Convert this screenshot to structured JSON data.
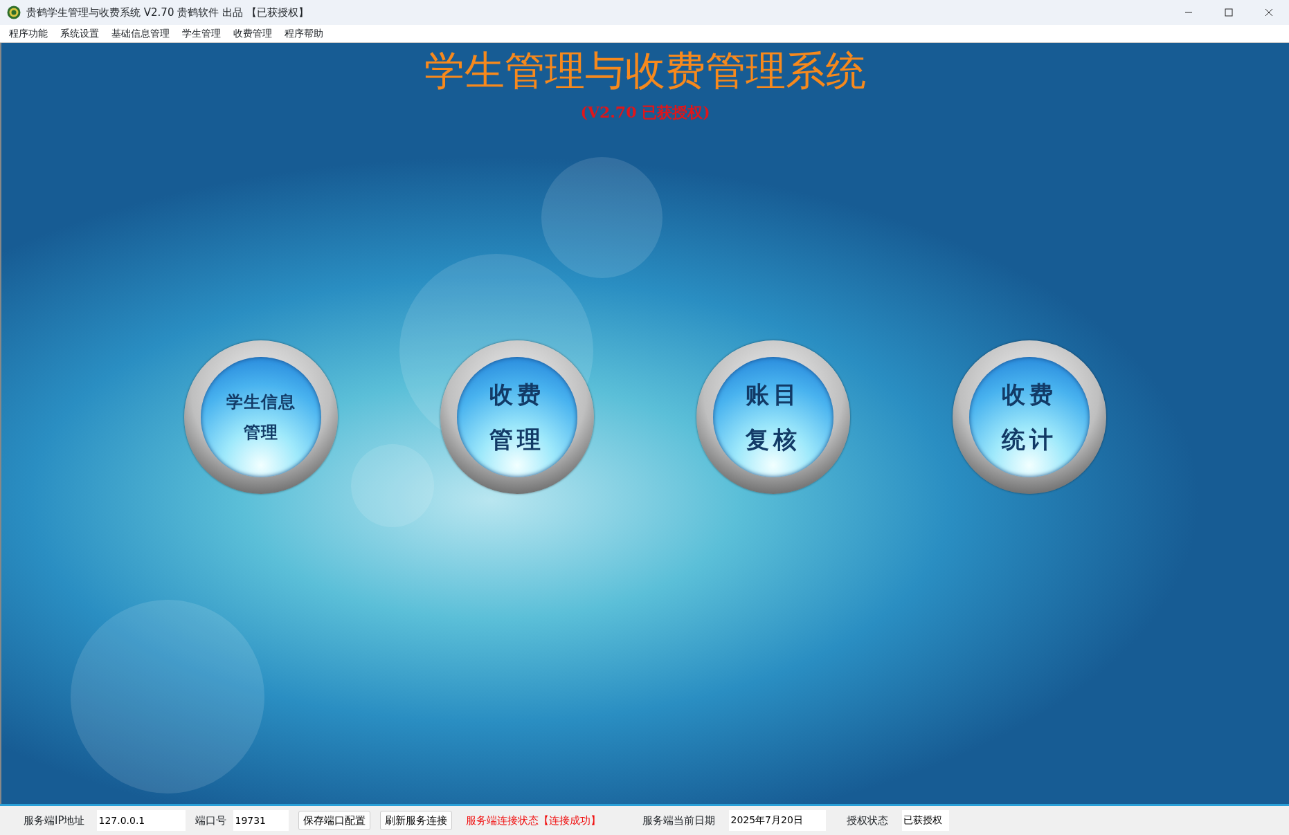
{
  "window": {
    "title": "贵鹤学生管理与收费系统 V2.70 贵鹤软件 出品 【已获授权】"
  },
  "menu": [
    "程序功能",
    "系统设置",
    "基础信息管理",
    "学生管理",
    "收费管理",
    "程序帮助"
  ],
  "heading": {
    "title": "学生管理与收费管理系统",
    "subtitle": "(V2.70 已获授权)"
  },
  "round_buttons": [
    {
      "lines": [
        "学生信息",
        "管理"
      ]
    },
    {
      "lines": [
        "收费",
        "管理"
      ]
    },
    {
      "lines": [
        "账目",
        "复核"
      ]
    },
    {
      "lines": [
        "收费",
        "统计"
      ]
    }
  ],
  "status_bar": [
    {
      "kind": "label",
      "text": "服务端IP地址"
    },
    {
      "kind": "field",
      "value": "127.0.0.1"
    },
    {
      "kind": "label",
      "text": "端口号"
    },
    {
      "kind": "field",
      "value": "19731"
    },
    {
      "kind": "button",
      "text": "保存端口配置"
    },
    {
      "kind": "button",
      "text": "刷新服务连接"
    },
    {
      "kind": "status",
      "text": "服务端连接状态【连接成功】"
    },
    {
      "kind": "label",
      "text": "服务端当前日期"
    },
    {
      "kind": "field",
      "value": "2025年7月20日"
    },
    {
      "kind": "label",
      "text": "授权状态"
    },
    {
      "kind": "field",
      "value": "已获授权"
    }
  ]
}
